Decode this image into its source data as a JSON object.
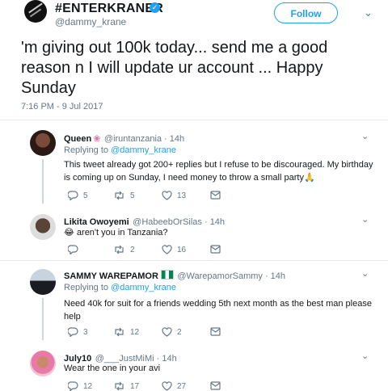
{
  "tweet": {
    "name": "#ENTERKRANER",
    "handle": "@dammy_krane",
    "follow_label": "Follow",
    "text": "'m giving out 100k today... send me a good reason n I will update ur account ...  Happy Sunday",
    "timestamp": "7:16 PM - 9 Jul 2017"
  },
  "replies": [
    {
      "name": "Queen",
      "handle": "@iruntanzania · 14h",
      "replying_prefix": "Replying to ",
      "replying_to": "@dammy_krane",
      "text": "This tweet already got 200+ replies but I refuse to be discouraged. My birthday is coming up on Sunday, I need money to throw a small party🙏",
      "replies": "5",
      "retweets": "5",
      "likes": "13"
    },
    {
      "name": "Likita Owoyemi",
      "handle": "@HabeebOrSilas · 14h",
      "text": "😂 aren't you in Tanzania?",
      "replies": "",
      "retweets": "2",
      "likes": "16"
    },
    {
      "name": "SAMMY WAREPAMOR",
      "handle": "@WarepamorSammy · 14h",
      "replying_prefix": "Replying to ",
      "replying_to": "@dammy_krane",
      "text": "Need 40k for suit for a friends wedding 5th next month as the best man please help",
      "replies": "3",
      "retweets": "12",
      "likes": "2"
    },
    {
      "name": "July10",
      "handle": "@___JustMiMi · 14h",
      "text": "Wear the one in your avi",
      "replies": "12",
      "retweets": "17",
      "likes": "27"
    }
  ],
  "colors": {
    "accent": "#1da1f2",
    "muted": "#657786",
    "text": "#14171a"
  }
}
